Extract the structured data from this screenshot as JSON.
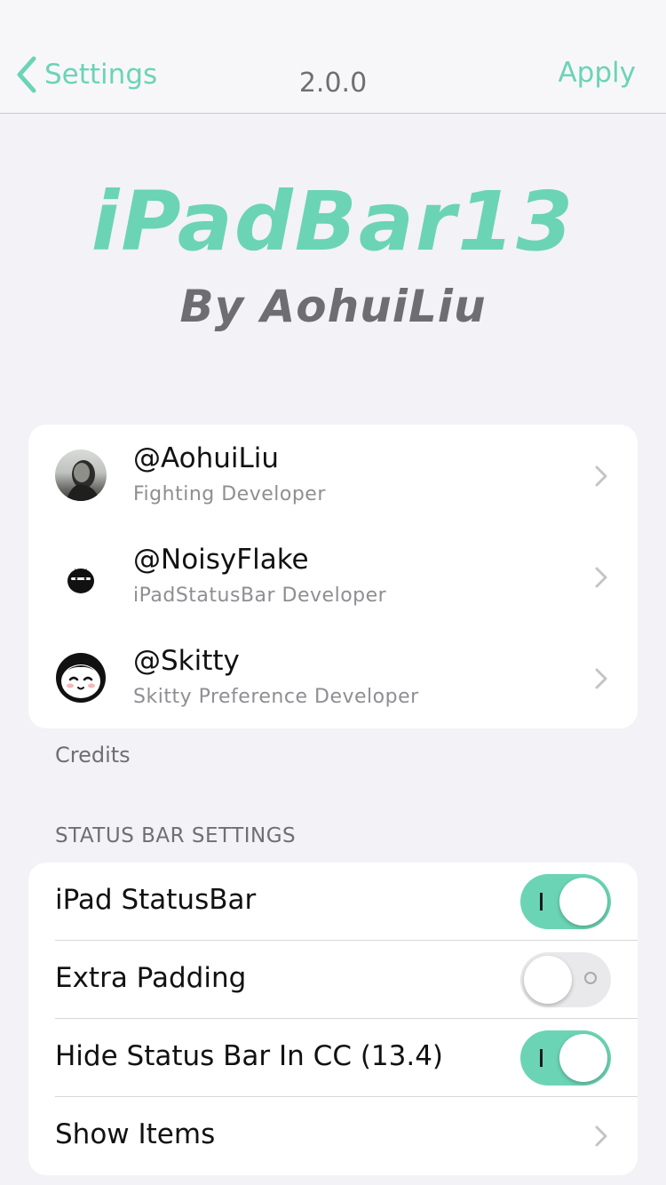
{
  "nav": {
    "back_label": "Settings",
    "title": "2.0.0",
    "apply_label": "Apply"
  },
  "header": {
    "title": "iPadBar13",
    "author": "By AohuiLiu"
  },
  "credits": {
    "items": [
      {
        "name": "@AohuiLiu",
        "role": "Fighting Developer"
      },
      {
        "name": "@NoisyFlake",
        "role": "iPadStatusBar Developer"
      },
      {
        "name": "@Skitty",
        "role": "Skitty Preference Developer"
      }
    ],
    "footer": "Credits"
  },
  "status_bar_settings": {
    "header": "STATUS BAR SETTINGS",
    "items": [
      {
        "label": "iPad StatusBar",
        "toggle": true
      },
      {
        "label": "Extra Padding",
        "toggle": false
      },
      {
        "label": "Hide Status Bar In CC (13.4)",
        "toggle": true
      },
      {
        "label": "Show Items"
      }
    ]
  },
  "colors": {
    "accent": "#6bd4b4",
    "background": "#f2f2f7"
  }
}
